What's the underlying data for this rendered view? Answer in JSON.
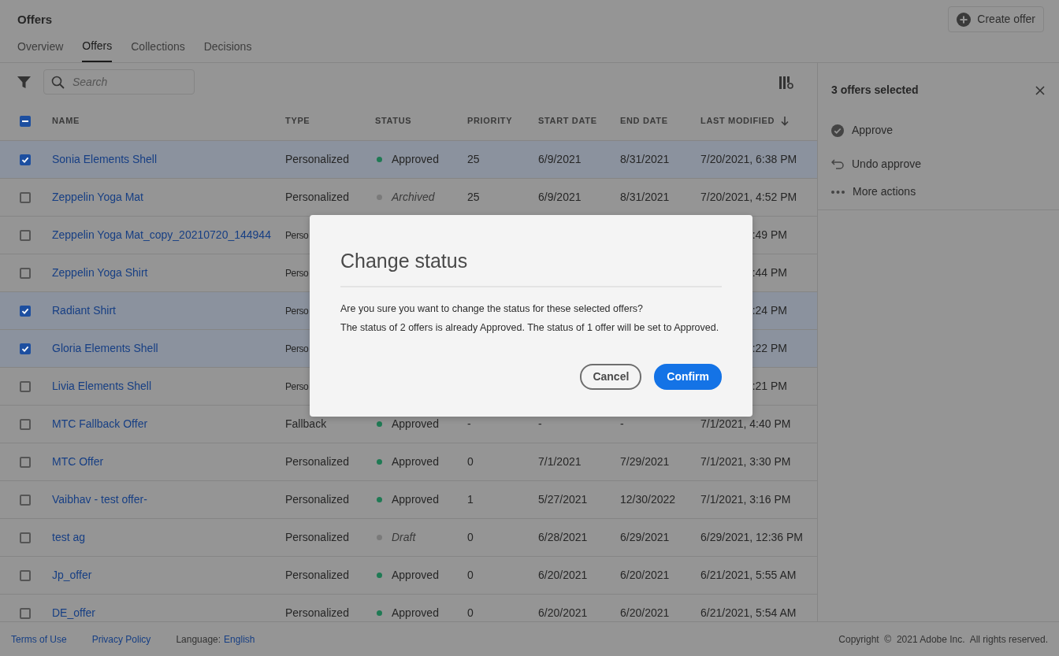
{
  "header": {
    "title": "Offers",
    "create_button": "Create offer"
  },
  "tabs": [
    {
      "label": "Overview",
      "selected": false
    },
    {
      "label": "Offers",
      "selected": true
    },
    {
      "label": "Collections",
      "selected": false
    },
    {
      "label": "Decisions",
      "selected": false
    }
  ],
  "search": {
    "placeholder": "Search"
  },
  "table": {
    "select_all_indeterminate": true,
    "columns": [
      {
        "label": "NAME",
        "sorted": false
      },
      {
        "label": "TYPE",
        "sorted": false
      },
      {
        "label": "STATUS",
        "sorted": false
      },
      {
        "label": "PRIORITY",
        "sorted": false
      },
      {
        "label": "START DATE",
        "sorted": false
      },
      {
        "label": "END DATE",
        "sorted": false
      },
      {
        "label": "LAST MODIFIED",
        "sorted": true
      }
    ],
    "rows": [
      {
        "selected": true,
        "name": "Sonia Elements Shell",
        "type": "Personalized",
        "status": "Approved",
        "color": "#1f7a54",
        "status_muted": false,
        "priority": "25",
        "start": "6/9/2021",
        "end": "8/31/2021",
        "modified": "7/20/2021, 6:38 PM"
      },
      {
        "selected": false,
        "name": "Zeppelin Yoga Mat",
        "type": "Personalized",
        "status": "Archived",
        "color": "#7a7a7a",
        "status_muted": true,
        "priority": "25",
        "start": "6/9/2021",
        "end": "8/31/2021",
        "modified": "7/20/2021, 4:52 PM"
      },
      {
        "selected": false,
        "name": "Zeppelin Yoga Mat_copy_20210720_144944",
        "type": "Perso",
        "modified": ":49 PM"
      },
      {
        "selected": false,
        "name": "Zeppelin Yoga Shirt",
        "type": "Perso",
        "modified": ":44 PM"
      },
      {
        "selected": true,
        "name": "Radiant Shirt",
        "type": "Perso",
        "modified": ":24 PM"
      },
      {
        "selected": true,
        "name": "Gloria Elements Shell",
        "type": "Perso",
        "modified": ":22 PM"
      },
      {
        "selected": false,
        "name": "Livia Elements Shell",
        "type": "Perso",
        "modified": ":21 PM"
      },
      {
        "selected": false,
        "name": "MTC Fallback Offer",
        "type": "Fallback",
        "status": "Approved",
        "color": "#1f7a54",
        "status_muted": false,
        "priority": "-",
        "start": "-",
        "end": "-",
        "modified": "7/1/2021, 4:40 PM"
      },
      {
        "selected": false,
        "name": "MTC Offer",
        "type": "Personalized",
        "status": "Approved",
        "color": "#1f7a54",
        "status_muted": false,
        "priority": "0",
        "start": "7/1/2021",
        "end": "7/29/2021",
        "modified": "7/1/2021, 3:30 PM"
      },
      {
        "selected": false,
        "name": "Vaibhav - test offer-",
        "type": "Personalized",
        "status": "Approved",
        "color": "#1f7a54",
        "status_muted": false,
        "priority": "1",
        "start": "5/27/2021",
        "end": "12/30/2022",
        "modified": "7/1/2021, 3:16 PM"
      },
      {
        "selected": false,
        "name": "test ag",
        "type": "Personalized",
        "status": "Draft",
        "color": "#7a7a7a",
        "status_muted": true,
        "priority": "0",
        "start": "6/28/2021",
        "end": "6/29/2021",
        "modified": "6/29/2021, 12:36 PM"
      },
      {
        "selected": false,
        "name": "Jp_offer",
        "type": "Personalized",
        "status": "Approved",
        "color": "#1f7a54",
        "status_muted": false,
        "priority": "0",
        "start": "6/20/2021",
        "end": "6/20/2021",
        "modified": "6/21/2021, 5:55 AM"
      },
      {
        "selected": false,
        "name": "DE_offer",
        "type": "Personalized",
        "status": "Approved",
        "color": "#1f7a54",
        "status_muted": false,
        "priority": "0",
        "start": "6/20/2021",
        "end": "6/20/2021",
        "modified": "6/21/2021, 5:54 AM"
      }
    ]
  },
  "side_panel": {
    "title": "3 offers selected",
    "actions": [
      {
        "kind": "approve",
        "label": "Approve"
      },
      {
        "kind": "undo",
        "label": "Undo approve"
      },
      {
        "kind": "more",
        "label": "More actions"
      }
    ]
  },
  "dialog": {
    "title": "Change status",
    "lines": [
      "Are you sure you want to change the status for these selected offers?",
      "The status of 2 offers is already Approved. The status of 1 offer will be set to Approved."
    ],
    "cancel": "Cancel",
    "confirm": "Confirm"
  },
  "footer": {
    "links": [
      "Terms of Use",
      "Privacy Policy"
    ],
    "language_label": "Language:",
    "language": "English",
    "copyright": "Copyright  ©  2021 Adobe Inc.  All rights reserved."
  }
}
